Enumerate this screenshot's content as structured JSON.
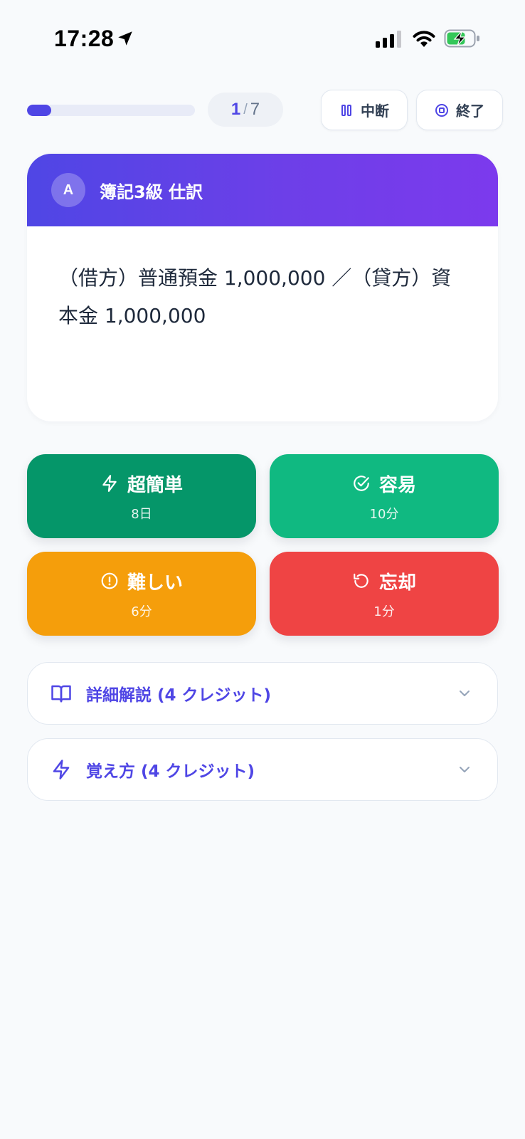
{
  "status_bar": {
    "time": "17:28"
  },
  "session": {
    "current": "1",
    "separator": "/",
    "total": "7",
    "progress_fraction": 0.143
  },
  "controls": {
    "pause_label": "中断",
    "end_label": "終了"
  },
  "card": {
    "badge": "A",
    "category": "簿記3級 仕訳",
    "question": "（借方）普通預金 1,000,000 ／（貸方）資本金 1,000,000"
  },
  "ratings": [
    {
      "label": "超簡単",
      "interval": "8日",
      "icon": "zap-icon",
      "color": "#059669"
    },
    {
      "label": "容易",
      "interval": "10分",
      "icon": "check-circle-icon",
      "color": "#10b981"
    },
    {
      "label": "難しい",
      "interval": "6分",
      "icon": "alert-circle-icon",
      "color": "#f59e0b"
    },
    {
      "label": "忘却",
      "interval": "1分",
      "icon": "rotate-ccw-icon",
      "color": "#ef4444"
    }
  ],
  "accordions": [
    {
      "label": "詳細解説 (4 クレジット)",
      "icon": "book-open-icon"
    },
    {
      "label": "覚え方 (4 クレジット)",
      "icon": "zap-icon"
    }
  ],
  "colors": {
    "accent": "#4f46e5",
    "header_gradient_end": "#7c3aed"
  }
}
